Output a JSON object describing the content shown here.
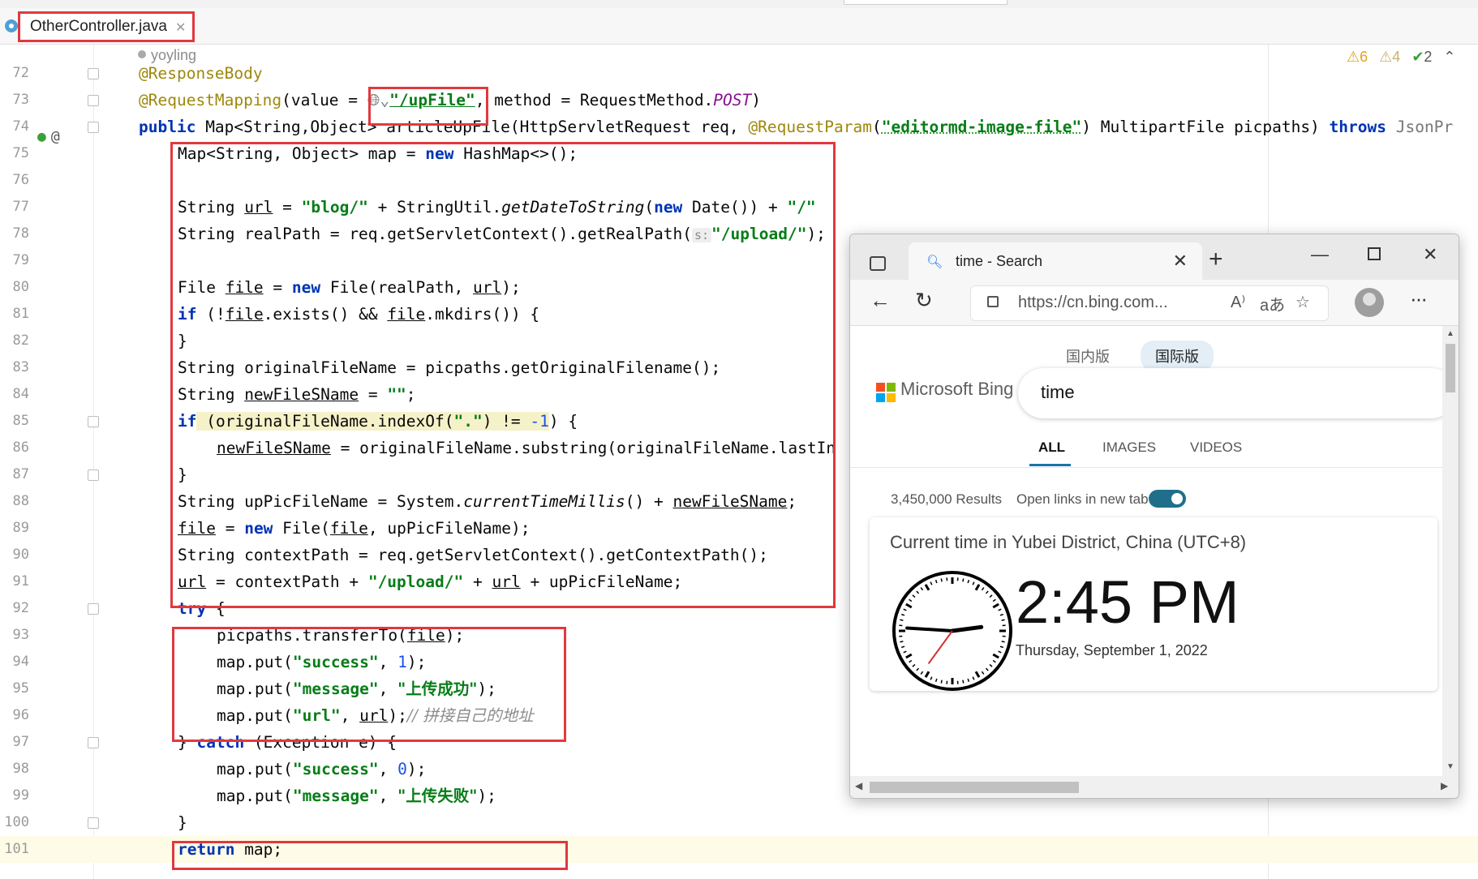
{
  "editor": {
    "tab_title": "OtherController.java",
    "author": "yoyling",
    "inspections": {
      "warnings": "6",
      "weak_warnings": "4",
      "typos": "2"
    },
    "current_line": "101",
    "lines": [
      {
        "n": "72"
      },
      {
        "n": "73"
      },
      {
        "n": "74"
      },
      {
        "n": "75"
      },
      {
        "n": "76"
      },
      {
        "n": "77"
      },
      {
        "n": "78"
      },
      {
        "n": "79"
      },
      {
        "n": "80"
      },
      {
        "n": "81"
      },
      {
        "n": "82"
      },
      {
        "n": "83"
      },
      {
        "n": "84"
      },
      {
        "n": "85"
      },
      {
        "n": "86"
      },
      {
        "n": "87"
      },
      {
        "n": "88"
      },
      {
        "n": "89"
      },
      {
        "n": "90"
      },
      {
        "n": "91"
      },
      {
        "n": "92"
      },
      {
        "n": "93"
      },
      {
        "n": "94"
      },
      {
        "n": "95"
      },
      {
        "n": "96"
      },
      {
        "n": "97"
      },
      {
        "n": "98"
      },
      {
        "n": "99"
      },
      {
        "n": "100"
      },
      {
        "n": "101"
      }
    ],
    "code": {
      "l72": "@ResponseBody",
      "l73_a": "@RequestMapping",
      "l73_b": "(value = ",
      "l73_str": "\"/upFile\"",
      "l73_c": ", method = RequestMethod.",
      "l73_post": "POST",
      "l73_d": ")",
      "l74_pub": "public",
      "l74_a": " Map<String,Object> articleUpFile(HttpServletRequest req, ",
      "l74_ann": "@RequestParam",
      "l74_p": "(",
      "l74_str": "\"editormd-image-file\"",
      "l74_b": ") MultipartFile picpaths) ",
      "l74_throws": "throws",
      "l74_c": " JsonPr",
      "l75_a": "Map<String, Object> map = ",
      "l75_new": "new",
      "l75_b": " HashMap<>();",
      "l77_a": "String ",
      "l77_url": "url",
      "l77_b": " = ",
      "l77_s1": "\"blog/\"",
      "l77_c": " + StringUtil.",
      "l77_m": "getDateToString",
      "l77_d": "(",
      "l77_new": "new",
      "l77_e": " Date()) + ",
      "l77_s2": "\"/\"",
      "l78_a": "String realPath = req.getServletContext().getRealPath(",
      "l78_hint": "s:",
      "l78_s": "\"/upload/\"",
      "l78_b": ");",
      "l80_a": "File ",
      "l80_file": "file",
      "l80_b": " = ",
      "l80_new": "new",
      "l80_c": " File(realPath, ",
      "l80_url": "url",
      "l80_d": ");",
      "l81_if": "if",
      "l81_a": " (!",
      "l81_f1": "file",
      "l81_b": ".exists() && ",
      "l81_f2": "file",
      "l81_c": ".mkdirs()) {",
      "l82": "}",
      "l83": "String originalFileName = picpaths.getOriginalFilename();",
      "l84_a": "String ",
      "l84_v": "newFileSName",
      "l84_b": " = ",
      "l84_s": "\"\"",
      "l84_c": ";",
      "l85_if": "if",
      "l85_a": " (originalFileName.indexOf(",
      "l85_s": "\".\"",
      "l85_b": ") != ",
      "l85_n": "-1",
      "l85_c": ") {",
      "l86_v": "newFileSName",
      "l86_a": " = originalFileName.substring(originalFileName.lastIn",
      "l87": "}",
      "l88_a": "String upPicFileName = System.",
      "l88_m": "currentTimeMillis",
      "l88_b": "() + ",
      "l88_v": "newFileSName",
      "l88_c": ";",
      "l89_f": "file",
      "l89_a": " = ",
      "l89_new": "new",
      "l89_b": " File(",
      "l89_f2": "file",
      "l89_c": ", upPicFileName);",
      "l90": "String contextPath = req.getServletContext().getContextPath();",
      "l91_u": "url",
      "l91_a": " = contextPath + ",
      "l91_s": "\"/upload/\"",
      "l91_b": " + ",
      "l91_u2": "url",
      "l91_c": " + upPicFileName;",
      "l92_try": "try",
      "l92_a": " {",
      "l93_a": "picpaths.transferTo(",
      "l93_f": "file",
      "l93_b": ");",
      "l94_a": "map.put(",
      "l94_s": "\"success\"",
      "l94_b": ", ",
      "l94_n": "1",
      "l94_c": ");",
      "l95_a": "map.put(",
      "l95_s": "\"message\"",
      "l95_b": ", ",
      "l95_s2": "\"上传成功\"",
      "l95_c": ");",
      "l96_a": "map.put(",
      "l96_s": "\"url\"",
      "l96_b": ", ",
      "l96_u": "url",
      "l96_c": ");",
      "l96_cm": "// 拼接自己的地址",
      "l97_a": "} ",
      "l97_catch": "catch",
      "l97_b": " (Exception e) {",
      "l98_a": "map.put(",
      "l98_s": "\"success\"",
      "l98_b": ", ",
      "l98_n": "0",
      "l98_c": ");",
      "l99_a": "map.put(",
      "l99_s": "\"message\"",
      "l99_b": ", ",
      "l99_s2": "\"上传失败\"",
      "l99_c": ");",
      "l100": "}",
      "l101_ret": "return",
      "l101_a": " map;"
    }
  },
  "browser": {
    "tab_title": "time - Search",
    "address": "https://cn.bing.com...",
    "region_tabs": [
      "国内版",
      "国际版"
    ],
    "active_region": "国际版",
    "brand": "Microsoft Bing",
    "query": "time",
    "scopes": [
      "ALL",
      "IMAGES",
      "VIDEOS"
    ],
    "active_scope": "ALL",
    "results_count": "3,450,000 Results",
    "open_links_label": "Open links in new tab",
    "open_links_on": true,
    "time_card": {
      "heading": "Current time in Yubei District, China (UTC+8)",
      "time": "2:45 PM",
      "date": "Thursday, September 1, 2022"
    },
    "clock": {
      "hour": 2,
      "minute": 45,
      "second": 36
    }
  },
  "colors": {
    "highlight_box": "#e0393e",
    "keyword": "#0033b3",
    "string": "#067d17",
    "number": "#1750eb",
    "annotation": "#9e880d"
  }
}
